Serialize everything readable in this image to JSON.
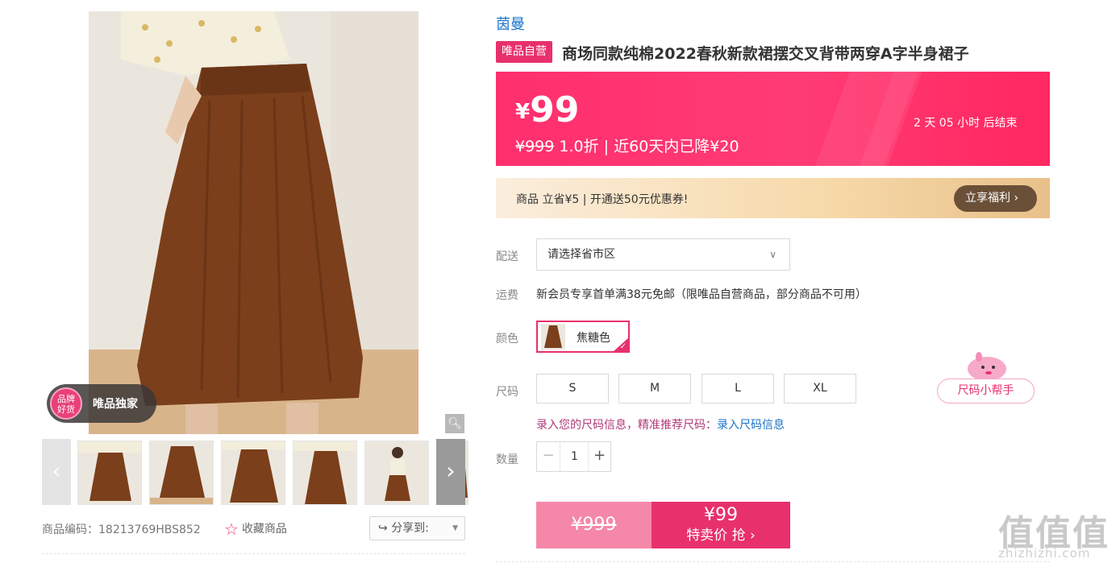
{
  "gallery": {
    "badge_seal_line1": "品牌",
    "badge_seal_line2": "好货",
    "badge_text": "唯品独家",
    "zoom_icon": "magnifier-icon",
    "prev_icon": "chevron-left-icon",
    "next_icon": "chevron-right-icon",
    "thumbnail_count": 6,
    "skirt_color": "#7b3f1b"
  },
  "meta": {
    "sku": "商品编码：18213769HBS852",
    "favorite_label": "收藏商品",
    "share_label": "分享到:"
  },
  "product": {
    "brand": "茵曼",
    "self_operated_tag": "唯品自营",
    "title": "商场同款纯棉2022春秋新款裙摆交叉背带两穿A字半身裙子"
  },
  "price": {
    "currency": "¥",
    "current": "99",
    "original": "¥999",
    "discount": "1.0折",
    "separator": "|",
    "drop_note": "近60天内已降¥20",
    "countdown": "2  天 05 小时 后结束",
    "accent_color": "#ff2f6d"
  },
  "promo": {
    "text": "商品 立省¥5 | 开通送50元优惠券!",
    "button": "立享福利"
  },
  "delivery": {
    "label": "配送",
    "select_value": "请选择省市区"
  },
  "freight": {
    "label": "运费",
    "text": "新会员专享首单满38元免邮（限唯品自营商品，部分商品不可用）"
  },
  "color": {
    "label": "颜色",
    "selected": "焦糖色"
  },
  "size": {
    "label": "尺码",
    "options": [
      "S",
      "M",
      "L",
      "XL"
    ],
    "note": "录入您的尺码信息，精准推荐尺码：",
    "note_link": "录入尺码信息",
    "helper": "尺码小帮手"
  },
  "quantity": {
    "label": "数量",
    "value": "1"
  },
  "buy": {
    "original": "¥999",
    "price": "¥99",
    "action": "特卖价 抢"
  },
  "watermark": {
    "big": "值值值",
    "small": "zhizhizhi.com"
  }
}
